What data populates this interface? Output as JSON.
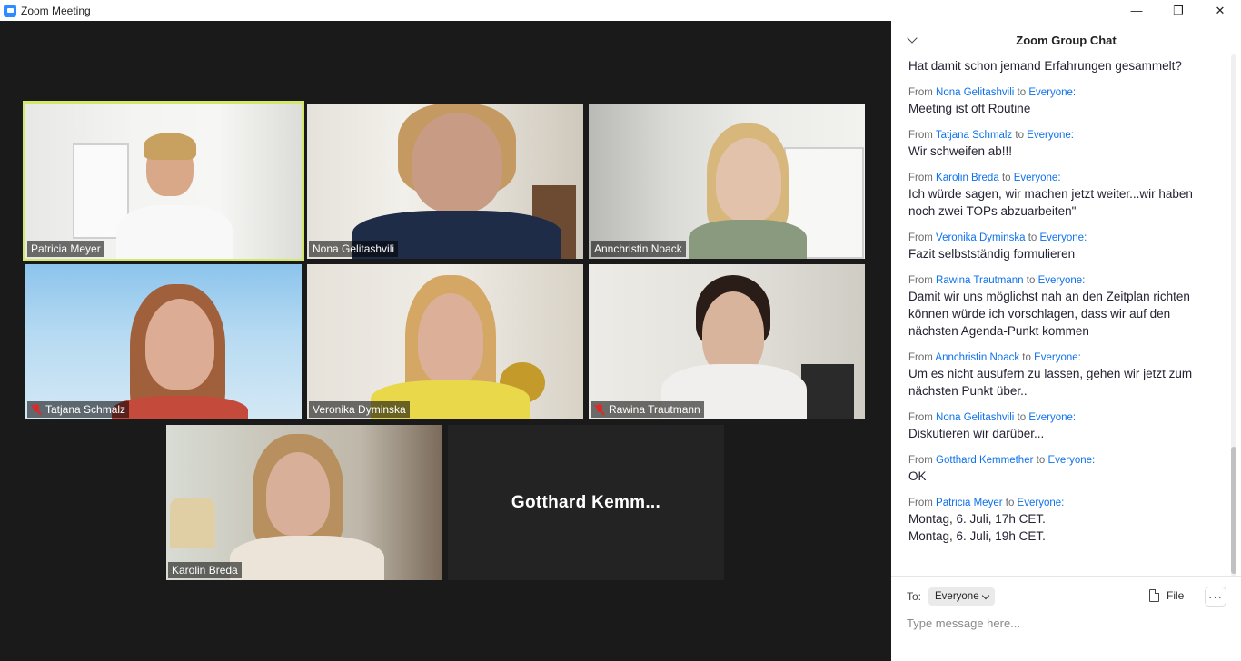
{
  "window": {
    "title": "Zoom Meeting",
    "minimize_glyph": "—",
    "maximize_glyph": "❐",
    "close_glyph": "✕"
  },
  "video": {
    "tiles": [
      {
        "name": "Patricia Meyer",
        "muted": false,
        "active": true
      },
      {
        "name": "Nona Gelitashvili",
        "muted": false,
        "active": false
      },
      {
        "name": "Annchristin Noack",
        "muted": false,
        "active": false
      },
      {
        "name": "Tatjana Schmalz",
        "muted": true,
        "active": false
      },
      {
        "name": "Veronika Dyminska",
        "muted": false,
        "active": false
      },
      {
        "name": "Rawina Trautmann",
        "muted": true,
        "active": false
      },
      {
        "name": "Karolin Breda",
        "muted": false,
        "active": false
      }
    ],
    "no_video_tile": {
      "name": "Gotthard  Kemm..."
    }
  },
  "chat": {
    "title": "Zoom Group Chat",
    "from_word": "From",
    "to_word": "to",
    "first_line": "Hat damit schon jemand Erfahrungen gesammelt?",
    "messages": [
      {
        "sender": "Nona Gelitashvili",
        "recipient": "Everyone:",
        "text": "Meeting ist oft Routine"
      },
      {
        "sender": "Tatjana Schmalz",
        "recipient": "Everyone:",
        "text": "Wir schweifen ab!!!"
      },
      {
        "sender": "Karolin Breda",
        "recipient": "Everyone:",
        "text": "Ich würde sagen, wir machen jetzt weiter...wir haben noch zwei TOPs abzuarbeiten\""
      },
      {
        "sender": "Veronika Dyminska",
        "recipient": "Everyone:",
        "text": "Fazit selbstständig formulieren"
      },
      {
        "sender": "Rawina Trautmann",
        "recipient": "Everyone:",
        "text": "Damit wir uns möglichst nah an den Zeitplan richten können würde ich vorschlagen, dass wir auf den nächsten Agenda-Punkt kommen"
      },
      {
        "sender": "Annchristin Noack",
        "recipient": "Everyone:",
        "text": "Um es nicht ausufern zu lassen, gehen wir jetzt zum nächsten Punkt über.."
      },
      {
        "sender": "Nona Gelitashvili",
        "recipient": "Everyone:",
        "text": "Diskutieren wir darüber..."
      },
      {
        "sender": "Gotthard Kemmether",
        "recipient": "Everyone:",
        "text": "OK"
      },
      {
        "sender": "Patricia Meyer",
        "recipient": "Everyone:",
        "text": "Montag, 6. Juli, 17h CET.\nMontag, 6. Juli, 19h CET."
      }
    ],
    "to_label": "To:",
    "recipient_select": "Everyone",
    "file_label": "File",
    "more_label": "···",
    "input_placeholder": "Type message here..."
  },
  "colors": {
    "active_speaker": "#d1e86a",
    "link": "#0e71eb",
    "muted": "#e02828",
    "brand": "#2d8cff"
  }
}
